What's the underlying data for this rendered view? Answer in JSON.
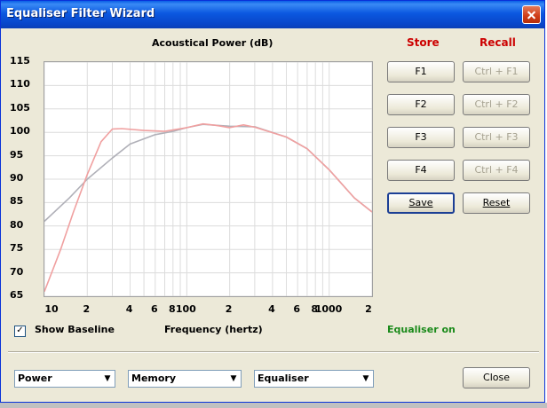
{
  "window": {
    "title": "Equaliser Filter Wizard"
  },
  "chart_data": {
    "type": "line",
    "title": "Acoustical Power (dB)",
    "xlabel": "Frequency (hertz)",
    "ylabel": "",
    "xscale": "log",
    "xlim": [
      10,
      2000
    ],
    "ylim": [
      65,
      115
    ],
    "yticks": [
      "115",
      "110",
      "105",
      "100",
      "95",
      "90",
      "85",
      "80",
      "75",
      "70",
      "65"
    ],
    "xticks": [
      "10",
      "2",
      "4",
      "6",
      "8",
      "100",
      "2",
      "4",
      "6",
      "8",
      "1000",
      "2"
    ],
    "series": [
      {
        "color": "#b0b0b8",
        "x": [
          10,
          15,
          20,
          30,
          40,
          60,
          80,
          100,
          130,
          200,
          300,
          500,
          700,
          1000,
          1500,
          2000
        ],
        "y": [
          81,
          86,
          90,
          94.5,
          97.5,
          99.5,
          100.2,
          101,
          101.7,
          101.3,
          101.2,
          99,
          96.5,
          92,
          86,
          83
        ]
      },
      {
        "color": "#f0a0a0",
        "x": [
          10,
          13,
          16,
          20,
          25,
          30,
          35,
          50,
          70,
          100,
          130,
          160,
          200,
          250,
          300,
          500,
          700,
          1000,
          1500,
          2000
        ],
        "y": [
          66,
          75,
          83,
          91,
          98,
          100.7,
          100.8,
          100.4,
          100.2,
          101,
          101.8,
          101.5,
          101.0,
          101.6,
          101.1,
          99,
          96.5,
          92,
          86,
          83
        ]
      }
    ]
  },
  "store": {
    "header": "Store",
    "buttons": [
      "F1",
      "F2",
      "F3",
      "F4"
    ]
  },
  "recall": {
    "header": "Recall",
    "buttons": [
      "Ctrl + F1",
      "Ctrl + F2",
      "Ctrl + F3",
      "Ctrl + F4"
    ]
  },
  "actions": {
    "save": "Save",
    "reset": "Reset",
    "close": "Close"
  },
  "baseline": {
    "label": "Show Baseline",
    "checked": "✓"
  },
  "status": {
    "equaliser": "Equaliser on"
  },
  "selects": {
    "power": "Power",
    "memory": "Memory",
    "equaliser": "Equaliser"
  },
  "colors": {
    "title_bar": "#0a5fe6",
    "header_red": "#cc0000",
    "status_green": "#1a8a1a"
  }
}
